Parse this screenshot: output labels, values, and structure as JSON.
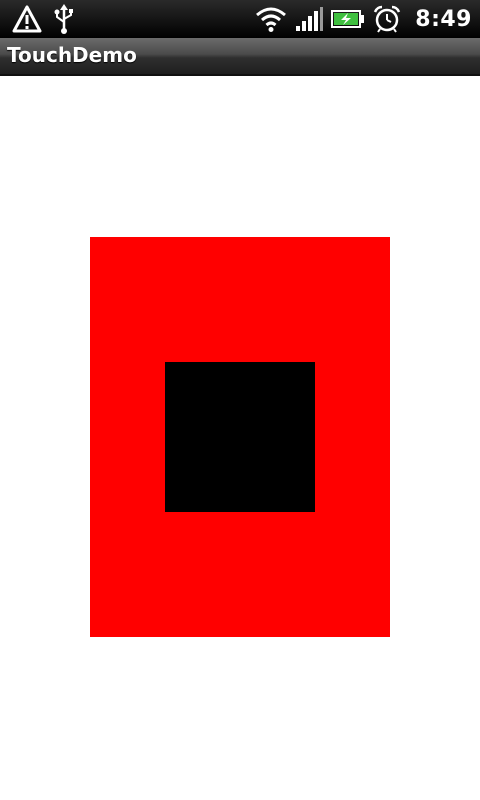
{
  "status_bar": {
    "time": "8:49",
    "left_icons": [
      "warning-icon",
      "usb-icon"
    ],
    "right_icons": [
      "wifi-icon",
      "signal-icon",
      "battery-charging-icon",
      "alarm-icon"
    ],
    "battery_level": 0.8
  },
  "app": {
    "title": "TouchDemo"
  },
  "colors": {
    "outer_rect": "#ff0000",
    "inner_square": "#000000",
    "background": "#ffffff"
  }
}
